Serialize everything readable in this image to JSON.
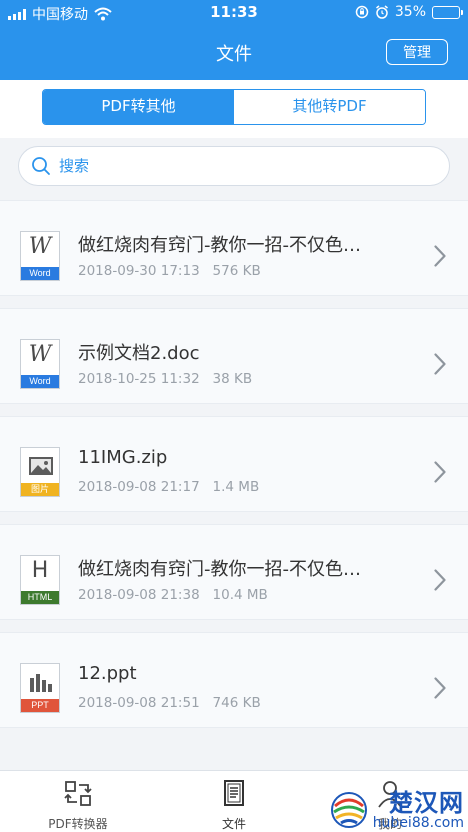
{
  "status": {
    "carrier": "中国移动",
    "time": "11:33",
    "battery": "35%",
    "battery_level": 0.35
  },
  "header": {
    "title": "文件",
    "manage_label": "管理"
  },
  "segments": [
    {
      "label": "PDF转其他",
      "active": true
    },
    {
      "label": "其他转PDF",
      "active": false
    }
  ],
  "search": {
    "placeholder": "搜索"
  },
  "files": [
    {
      "name": "做红烧肉有窍门-教你一招-不仅色…",
      "date": "2018-09-30 17:13",
      "size": "576 KB",
      "type": "word",
      "icon_glyph": "W",
      "tag": "Word",
      "tag_color": "#2a7be0"
    },
    {
      "name": "示例文档2.doc",
      "date": "2018-10-25 11:32",
      "size": "38 KB",
      "type": "word",
      "icon_glyph": "W",
      "tag": "Word",
      "tag_color": "#2a7be0"
    },
    {
      "name": "11IMG.zip",
      "date": "2018-09-08 21:17",
      "size": "1.4 MB",
      "type": "image",
      "icon_glyph": "",
      "tag": "图片",
      "tag_color": "#f0b321"
    },
    {
      "name": "做红烧肉有窍门-教你一招-不仅色…",
      "date": "2018-09-08 21:38",
      "size": "10.4 MB",
      "type": "html",
      "icon_glyph": "H",
      "tag": "HTML",
      "tag_color": "#3d7a2e"
    },
    {
      "name": "12.ppt",
      "date": "2018-09-08 21:51",
      "size": "746 KB",
      "type": "ppt",
      "icon_glyph": "",
      "tag": "PPT",
      "tag_color": "#e0553b"
    }
  ],
  "tabbar": [
    {
      "label": "PDF转换器",
      "icon": "convert-icon"
    },
    {
      "label": "文件",
      "icon": "document-icon"
    },
    {
      "label": "我的",
      "icon": "user-icon"
    }
  ],
  "watermark": {
    "text": "楚汉网",
    "url": "hubei88.com"
  },
  "colors": {
    "accent": "#2a93ec"
  }
}
